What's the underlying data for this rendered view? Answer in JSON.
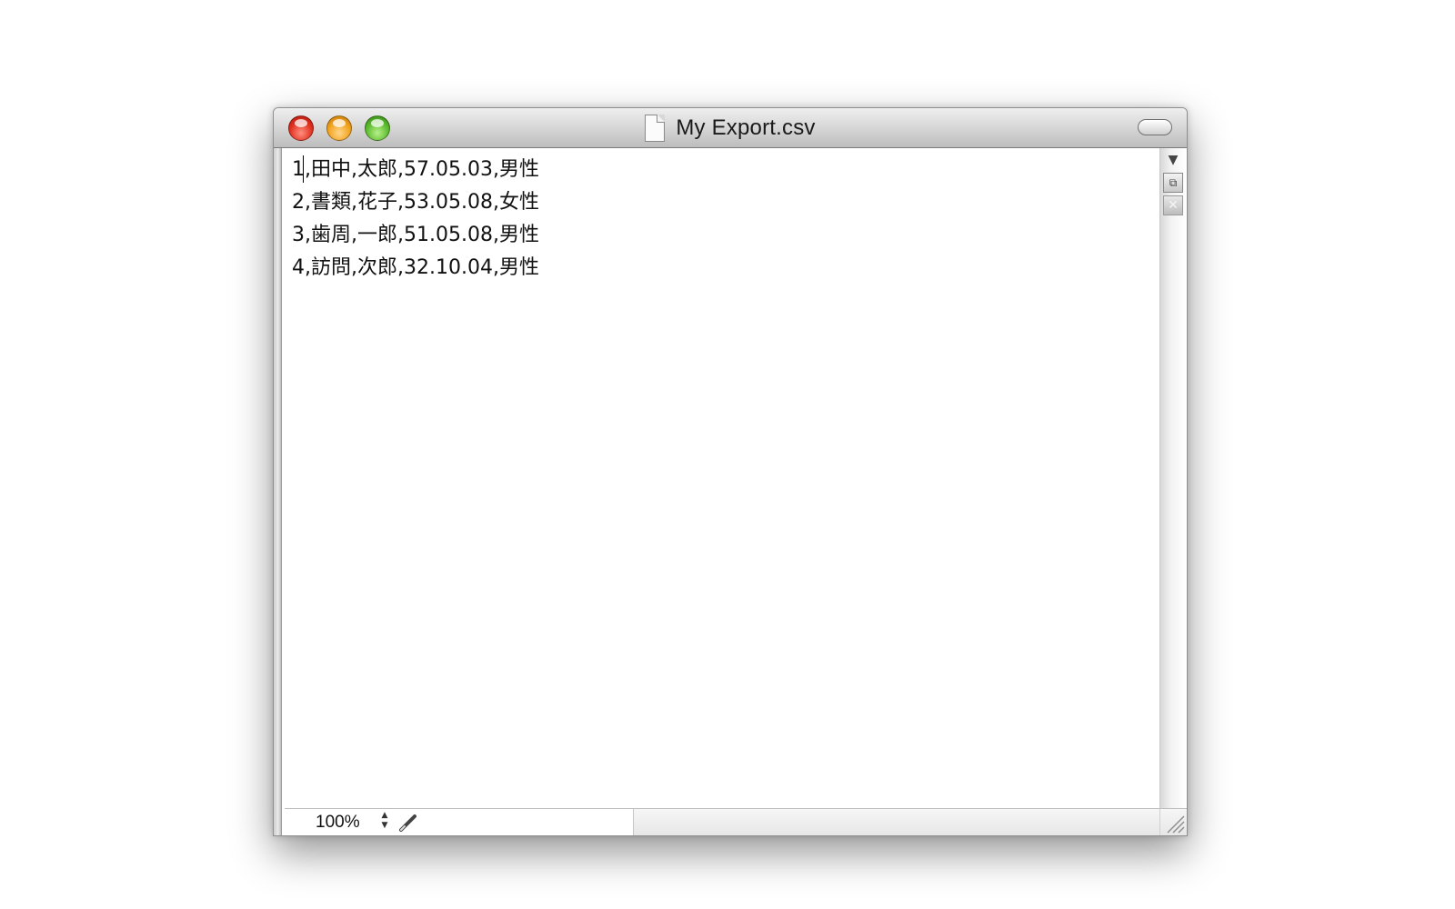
{
  "window": {
    "title": "My Export.csv",
    "controls": {
      "close_icon": "close-icon",
      "minimize_icon": "minimize-icon",
      "zoom_icon": "zoom-icon"
    }
  },
  "document": {
    "lines": [
      "1,田中,太郎,57.05.03,男性",
      "2,書類,花子,53.05.08,女性",
      "3,歯周,一郎,51.05.08,男性",
      "4,訪問,次郎,32.10.04,男性"
    ]
  },
  "status_bar": {
    "zoom": "100%",
    "stepper_up": "▲",
    "stepper_down": "▼"
  },
  "side_controls": {
    "dropdown": "▼",
    "split": "⧉",
    "close": "✕"
  },
  "colors": {
    "close_button": "#e0301e",
    "minimize_button": "#f2a21c",
    "zoom_button": "#5cbb2e"
  }
}
